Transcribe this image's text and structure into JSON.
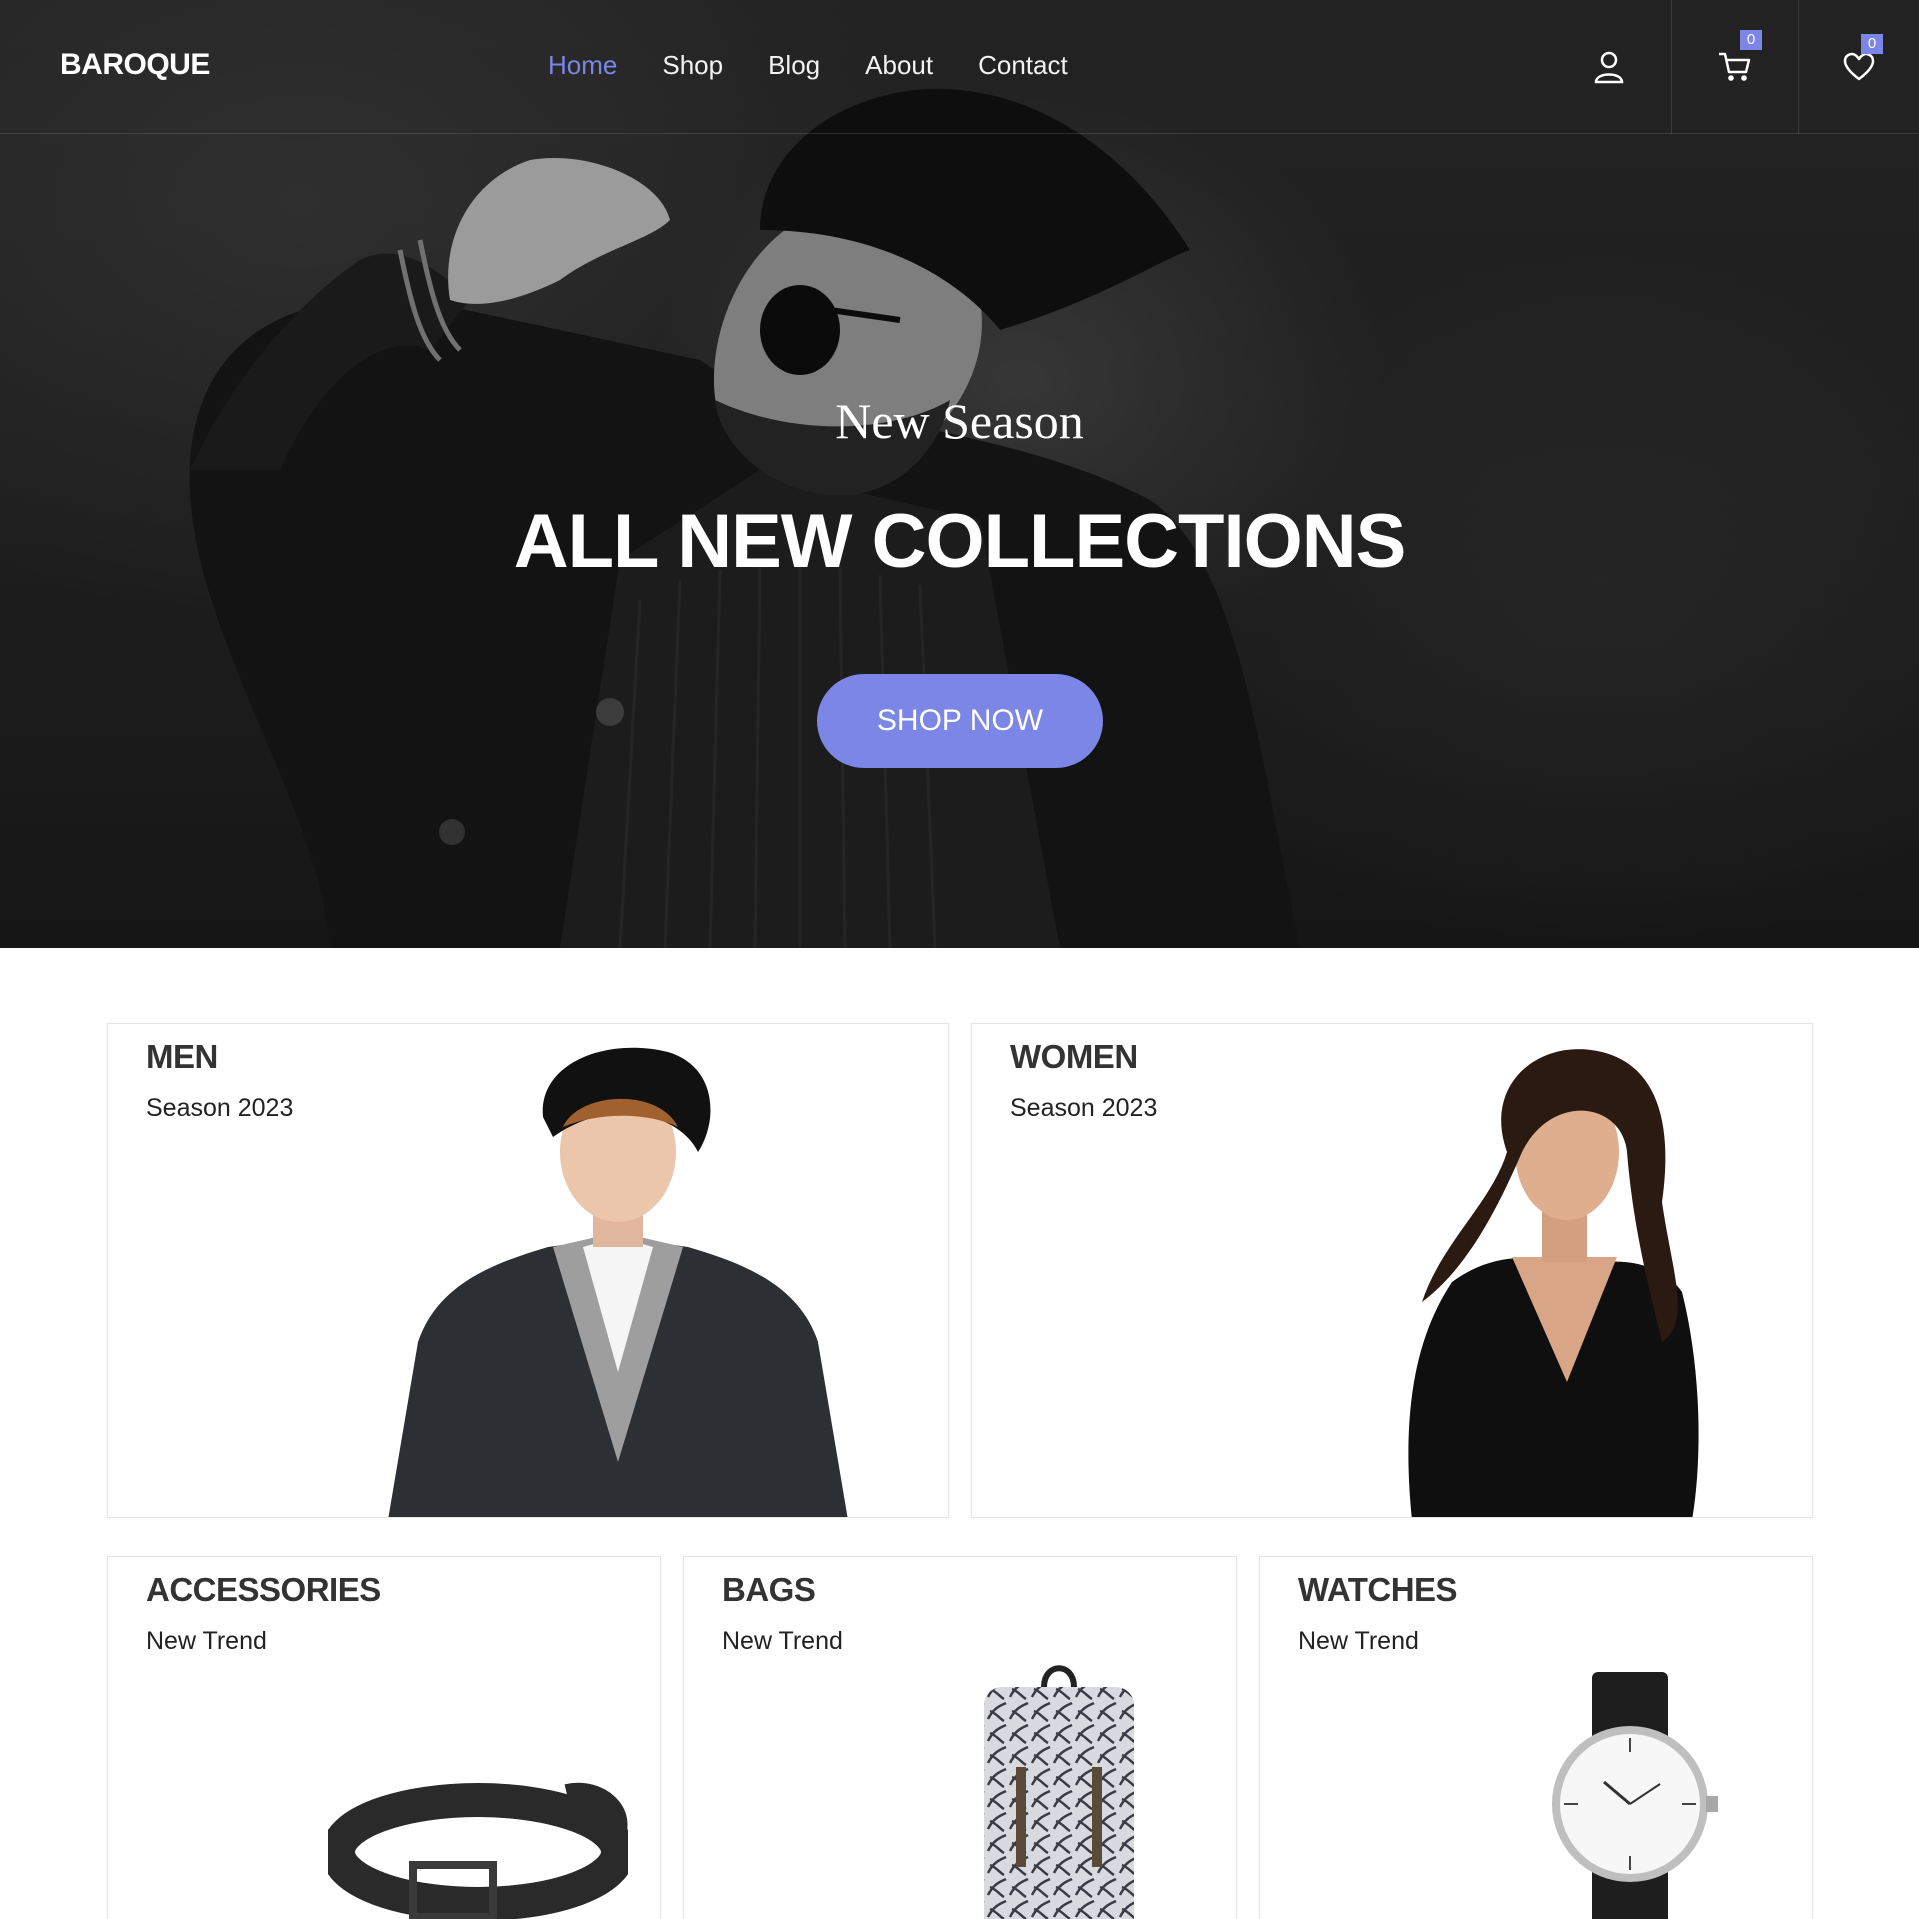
{
  "brand": {
    "logo": "BAROQUE",
    "accent_color": "#7b86e6"
  },
  "nav": {
    "items": [
      {
        "label": "Home",
        "active": true
      },
      {
        "label": "Shop",
        "active": false
      },
      {
        "label": "Blog",
        "active": false
      },
      {
        "label": "About",
        "active": false
      },
      {
        "label": "Contact",
        "active": false
      }
    ]
  },
  "header_icons": {
    "account": {
      "icon": "user-icon"
    },
    "cart": {
      "icon": "cart-icon",
      "count": "0"
    },
    "wishlist": {
      "icon": "heart-icon",
      "count": "0"
    }
  },
  "hero": {
    "subtitle": "New Season",
    "title": "ALL NEW COLLECTIONS",
    "button_label": "SHOP NOW"
  },
  "categories": [
    {
      "title": "MEN",
      "subtitle": "Season 2023"
    },
    {
      "title": "WOMEN",
      "subtitle": "Season 2023"
    },
    {
      "title": "ACCESSORIES",
      "subtitle": "New Trend"
    },
    {
      "title": "BAGS",
      "subtitle": "New Trend"
    },
    {
      "title": "WATCHES",
      "subtitle": "New Trend"
    }
  ]
}
